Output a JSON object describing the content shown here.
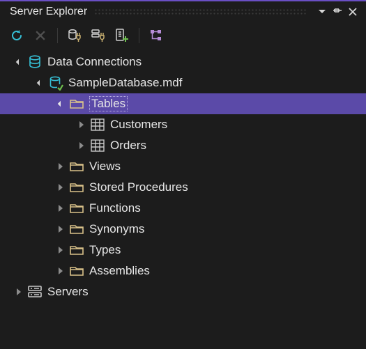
{
  "panel": {
    "title": "Server Explorer"
  },
  "toolbar": {
    "refresh": "Refresh",
    "cancel": "Cancel",
    "connect_db": "Connect to Database",
    "connect_server": "Connect to Server",
    "add_service": "Add Data Service",
    "group": "Group"
  },
  "tree": {
    "data_connections": "Data Connections",
    "database": "SampleDatabase.mdf",
    "folders": {
      "tables": "Tables",
      "views": "Views",
      "stored_procedures": "Stored Procedures",
      "functions": "Functions",
      "synonyms": "Synonyms",
      "types": "Types",
      "assemblies": "Assemblies"
    },
    "tables": {
      "customers": "Customers",
      "orders": "Orders"
    },
    "servers": "Servers"
  },
  "colors": {
    "accent": "#6a4fc4",
    "selection": "#5b4aa8",
    "folder": "#d9c28a",
    "cyan": "#36c0d6"
  }
}
